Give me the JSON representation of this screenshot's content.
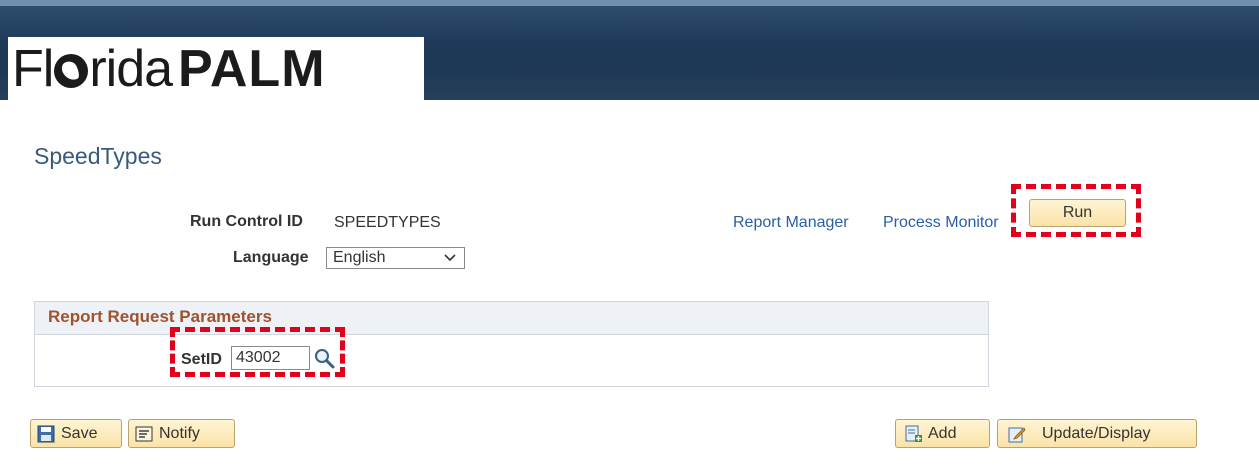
{
  "header": {
    "logo_light": "Fl",
    "logo_light2": "rida",
    "logo_bold": "PALM"
  },
  "page": {
    "title": "SpeedTypes"
  },
  "run_control": {
    "label": "Run Control ID",
    "value": "SPEEDTYPES"
  },
  "language": {
    "label": "Language",
    "selected": "English"
  },
  "links": {
    "report_manager": "Report Manager",
    "process_monitor": "Process Monitor"
  },
  "buttons": {
    "run": "Run",
    "save": "Save",
    "notify": "Notify",
    "add": "Add",
    "update_display": "Update/Display"
  },
  "parameters": {
    "title": "Report Request Parameters",
    "setid_label": "SetID",
    "setid_value": "43002"
  },
  "colors": {
    "header": "#1e3a58",
    "title": "#385a7e",
    "link": "#2a5fa6",
    "group_title": "#a0522d",
    "highlight": "#e3001b"
  },
  "icons": {
    "save": "floppy-disk-icon",
    "notify": "notify-icon",
    "add": "add-document-icon",
    "update": "pencil-edit-icon",
    "lookup": "magnifier-icon",
    "dropdown": "chevron-down-icon"
  }
}
